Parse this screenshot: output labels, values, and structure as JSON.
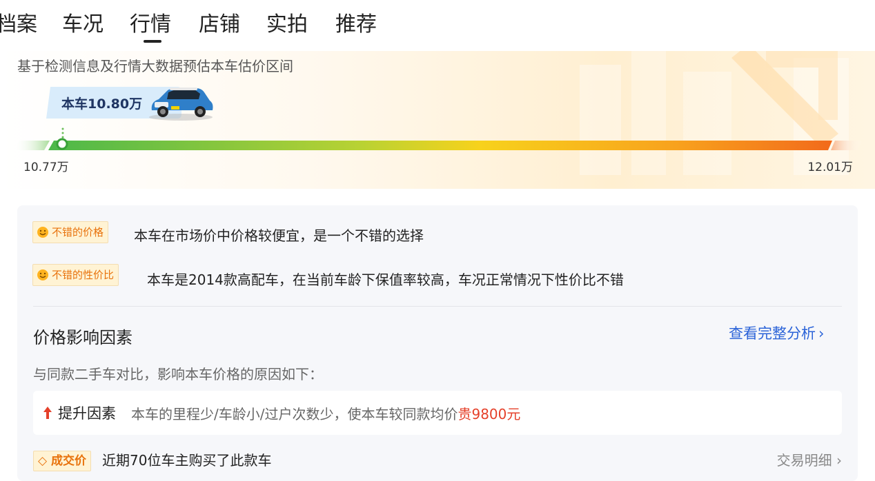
{
  "tabs": [
    {
      "label": "档案"
    },
    {
      "label": "车况"
    },
    {
      "label": "行情"
    },
    {
      "label": "店铺"
    },
    {
      "label": "实拍"
    },
    {
      "label": "推荐"
    }
  ],
  "active_tab": "行情",
  "valuation": {
    "subtitle": "基于检测信息及行情大数据预估本车估价区间",
    "current_price_label": "本车10.80万",
    "range_low": "10.77万",
    "range_high": "12.01万",
    "marker_position_fraction": 0.05
  },
  "highlights": [
    {
      "tag": "不错的价格",
      "text": "本车在市场价中价格较便宜，是一个不错的选择",
      "icon": "smile-icon"
    },
    {
      "tag": "不错的性价比",
      "text": "本车是2014款高配车，在当前车龄下保值率较高，车况正常情况下性价比不错",
      "icon": "smile-icon"
    }
  ],
  "price_factors": {
    "title": "价格影响因素",
    "link": "查看完整分析",
    "description": "与同款二手车对比，影响本车价格的原因如下：",
    "factor": {
      "title": "提升因素",
      "text": "本车的里程少/车龄小/过户次数少，使本车较同款均价",
      "highlight": "贵9800元",
      "icon": "arrow-up-icon"
    }
  },
  "deal": {
    "tag": "成交价",
    "text": "近期70位车主购买了此款车",
    "link": "交易明细"
  },
  "colors": {
    "accent_blue": "#2b63d8",
    "tag_orange": "#e8720c",
    "highlight_red": "#e5402a",
    "bar_start": "#4cb84a",
    "bar_mid": "#f7d21c",
    "bar_end": "#f26a1b"
  }
}
